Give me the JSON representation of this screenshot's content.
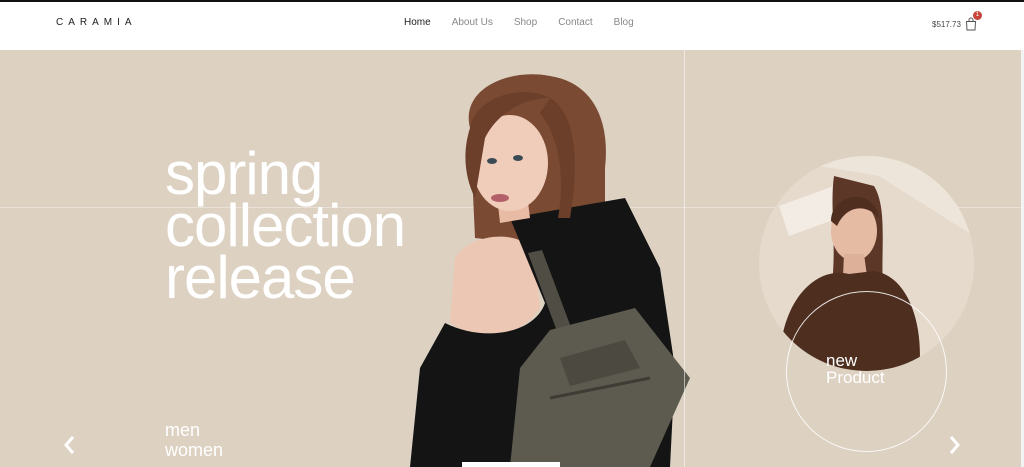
{
  "brand": {
    "logo": "CARAMIA"
  },
  "nav": {
    "items": [
      {
        "label": "Home",
        "active": true
      },
      {
        "label": "About Us",
        "active": false
      },
      {
        "label": "Shop",
        "active": false
      },
      {
        "label": "Contact",
        "active": false
      },
      {
        "label": "Blog",
        "active": false
      }
    ]
  },
  "cart": {
    "total": "$517.73",
    "count": "1",
    "icon": "shopping-bag-icon"
  },
  "hero": {
    "headline": [
      "spring",
      "collection",
      "release"
    ],
    "categories": [
      "men",
      "women"
    ],
    "prev_icon": "chevron-left-icon",
    "next_icon": "chevron-right-icon",
    "promo_label": [
      "new",
      "Product"
    ],
    "colors": {
      "background": "#ddd1c2",
      "text": "#ffffff",
      "badge": "#c7443a"
    }
  }
}
